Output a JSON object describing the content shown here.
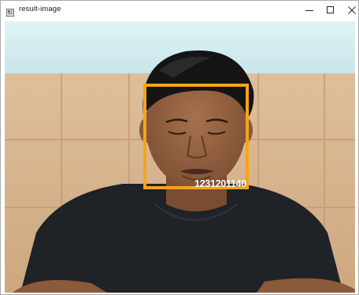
{
  "window": {
    "title": "result-image",
    "controls": {
      "minimize": "minimize-icon",
      "maximize": "maximize-icon",
      "close": "close-icon"
    }
  },
  "image": {
    "detection": {
      "label": "1231201140",
      "box_color": "#f4a41c"
    }
  }
}
